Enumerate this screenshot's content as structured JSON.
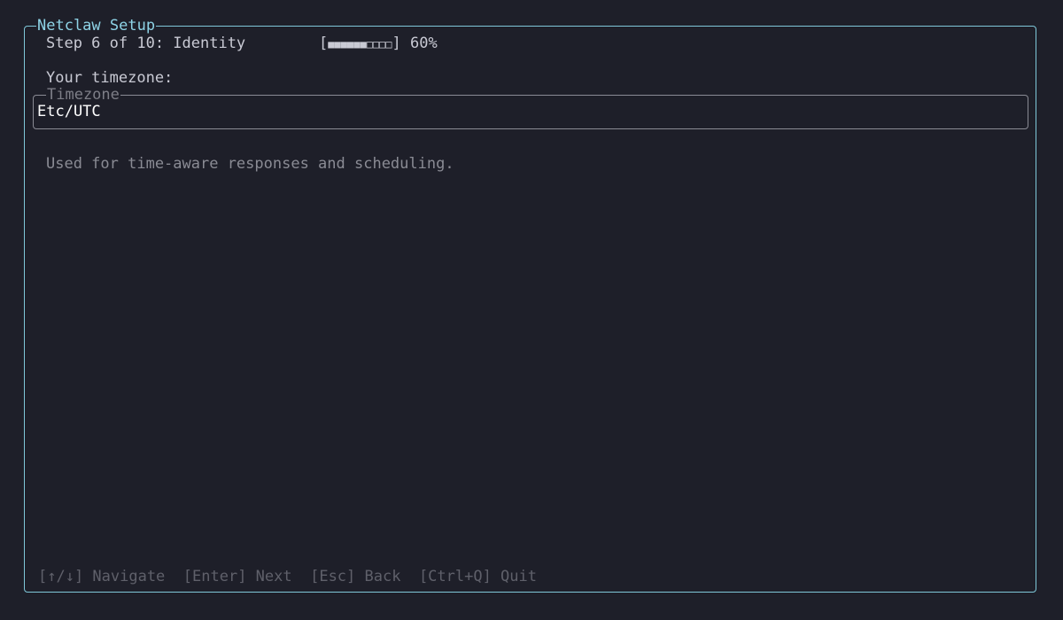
{
  "window": {
    "title": "Netclaw Setup"
  },
  "step": {
    "label": "Step 6 of 10: Identity"
  },
  "progress": {
    "open_bracket": "[",
    "filled": "■■■■■■",
    "empty": "□□□□",
    "close_bracket": "]",
    "percent_text": "60%",
    "value": 0.6
  },
  "form": {
    "prompt": "Your timezone:",
    "field_label": "Timezone",
    "field_value": "Etc/UTC",
    "hint": "Used for time-aware responses and scheduling."
  },
  "footer": {
    "navigate": "[↑/↓] Navigate",
    "next": "[Enter] Next",
    "back": "[Esc] Back",
    "quit": "[Ctrl+Q] Quit"
  },
  "colors": {
    "background": "#1e1f29",
    "border_accent": "#7fc8d9",
    "title": "#8ed3e6",
    "text": "#c9cad4",
    "muted": "#8a8b94",
    "footer": "#5f606a"
  }
}
